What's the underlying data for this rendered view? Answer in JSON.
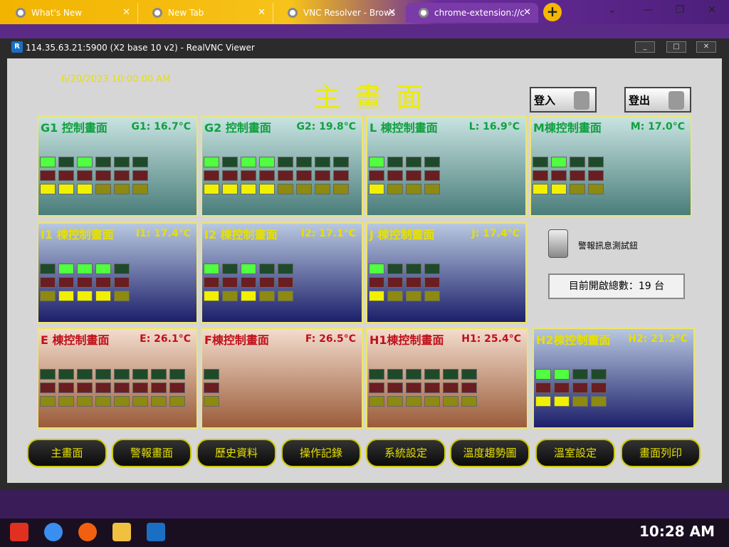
{
  "browser": {
    "tabs": [
      {
        "label": "What's New"
      },
      {
        "label": "New Tab"
      },
      {
        "label": "VNC Resolver - Brows"
      },
      {
        "label": "chrome-extension://c"
      }
    ],
    "new_tab": "+"
  },
  "vnc": {
    "title": "114.35.63.21:5900 (X2 base 10 v2) - RealVNC Viewer",
    "logo": "R"
  },
  "hmi": {
    "timestamp": "6/20/2023 10:00:00 AM",
    "title": "主畫面",
    "login_label": "登入",
    "logout_label": "登出",
    "alarm_test_label": "警報訊息測試鈕",
    "open_count": "目前開啟總數：19 台",
    "panels": [
      {
        "title": "G1 控制畫面",
        "temp": "G1: 16.7°C",
        "cols": 6,
        "green": [
          1,
          0,
          1,
          0,
          0,
          0
        ],
        "yellow": [
          1,
          1,
          1,
          0,
          0,
          0
        ]
      },
      {
        "title": "G2 控制畫面",
        "temp": "G2: 19.8°C",
        "cols": 8,
        "green": [
          1,
          0,
          1,
          1,
          0,
          0,
          0,
          0
        ],
        "yellow": [
          1,
          1,
          1,
          1,
          0,
          0,
          0,
          0
        ]
      },
      {
        "title": "L 棟控制畫面",
        "temp": "L: 16.9°C",
        "cols": 4,
        "green": [
          1,
          0,
          0,
          0
        ],
        "yellow": [
          1,
          0,
          0,
          0
        ]
      },
      {
        "title": "M棟控制畫面",
        "temp": "M: 17.0°C",
        "cols": 4,
        "green": [
          0,
          1,
          0,
          0
        ],
        "yellow": [
          1,
          1,
          0,
          0
        ]
      },
      {
        "title": "I1 棟控制畫面",
        "temp": "I1: 17.4°C",
        "cols": 5,
        "green": [
          0,
          1,
          1,
          1,
          0
        ],
        "yellow": [
          0,
          1,
          1,
          1,
          0
        ]
      },
      {
        "title": "I2 棟控制畫面",
        "temp": "I2: 17.1°C",
        "cols": 5,
        "green": [
          1,
          0,
          1,
          0,
          0
        ],
        "yellow": [
          1,
          0,
          1,
          0,
          0
        ]
      },
      {
        "title": "J 棟控制畫面",
        "temp": "J: 17.4°C",
        "cols": 4,
        "green": [
          1,
          0,
          0,
          0
        ],
        "yellow": [
          1,
          0,
          0,
          0
        ]
      },
      {
        "title": "E 棟控制畫面",
        "temp": "E: 26.1°C",
        "cols": 8,
        "green": [
          0,
          0,
          0,
          0,
          0,
          0,
          0,
          0
        ],
        "yellow": [
          0,
          0,
          0,
          0,
          0,
          0,
          0,
          0
        ]
      },
      {
        "title": "F棟控制畫面",
        "temp": "F: 26.5°C",
        "cols": 1,
        "green": [
          0
        ],
        "yellow": [
          0
        ]
      },
      {
        "title": "H1棟控制畫面",
        "temp": "H1: 25.4°C",
        "cols": 6,
        "green": [
          0,
          0,
          0,
          0,
          0,
          0
        ],
        "yellow": [
          0,
          0,
          0,
          0,
          0,
          0
        ]
      },
      {
        "title": "H2棟控制畫面",
        "temp": "H2: 21.2°C",
        "cols": 4,
        "green": [
          1,
          1,
          0,
          0
        ],
        "yellow": [
          1,
          1,
          0,
          0
        ]
      }
    ],
    "nav": [
      "主畫面",
      "警報畫面",
      "歷史資料",
      "操作記錄",
      "系統設定",
      "溫度趨勢圖",
      "溫室設定",
      "畫面列印"
    ]
  },
  "taskbar": {
    "clock": "10:28 AM"
  }
}
